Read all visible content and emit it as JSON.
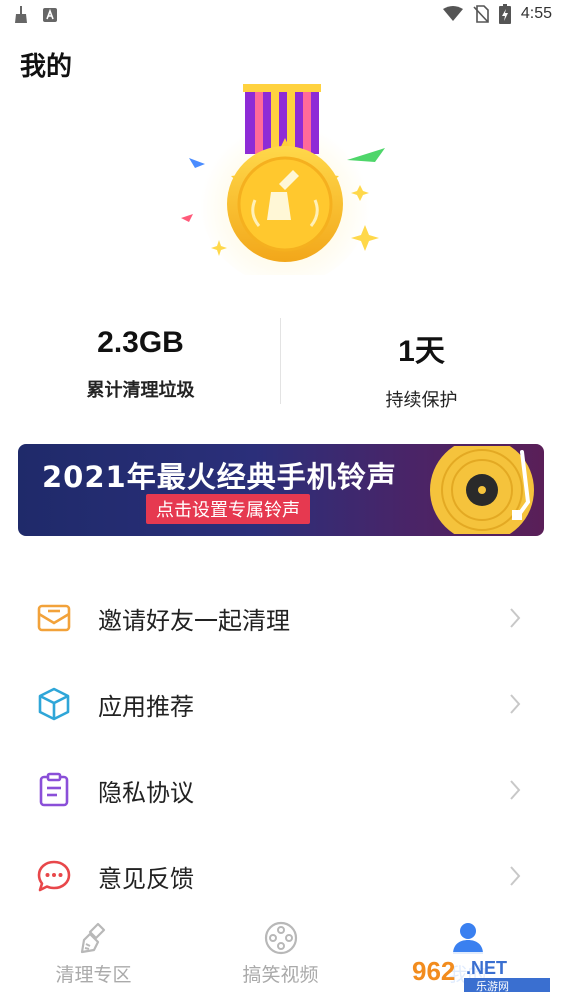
{
  "status_bar": {
    "time": "4:55"
  },
  "header": {
    "title": "我的"
  },
  "stats": [
    {
      "value": "2.3GB",
      "label": "累计清理垃圾"
    },
    {
      "value": "1天",
      "label": "持续保护"
    }
  ],
  "banner": {
    "title": "2021年最火经典手机铃声",
    "cta": "点击设置专属铃声"
  },
  "menu": [
    {
      "label": "邀请好友一起清理",
      "icon": "mail-icon",
      "color": "#f2a23a"
    },
    {
      "label": "应用推荐",
      "icon": "cube-icon",
      "color": "#2fa6d8"
    },
    {
      "label": "隐私协议",
      "icon": "clipboard-icon",
      "color": "#8a4fd8"
    },
    {
      "label": "意见反馈",
      "icon": "chat-icon",
      "color": "#e8474a"
    }
  ],
  "bottom_nav": [
    {
      "label": "清理专区",
      "icon": "broom-icon",
      "active": false
    },
    {
      "label": "搞笑视频",
      "icon": "film-reel-icon",
      "active": false
    },
    {
      "label": "我的",
      "icon": "user-icon",
      "active": true
    }
  ],
  "watermark": {
    "text": "962.NET",
    "subtext": "乐游网"
  },
  "colors": {
    "accent": "#3a80f0",
    "banner_cta": "#e63950",
    "medal_gold": "#f7c331"
  }
}
